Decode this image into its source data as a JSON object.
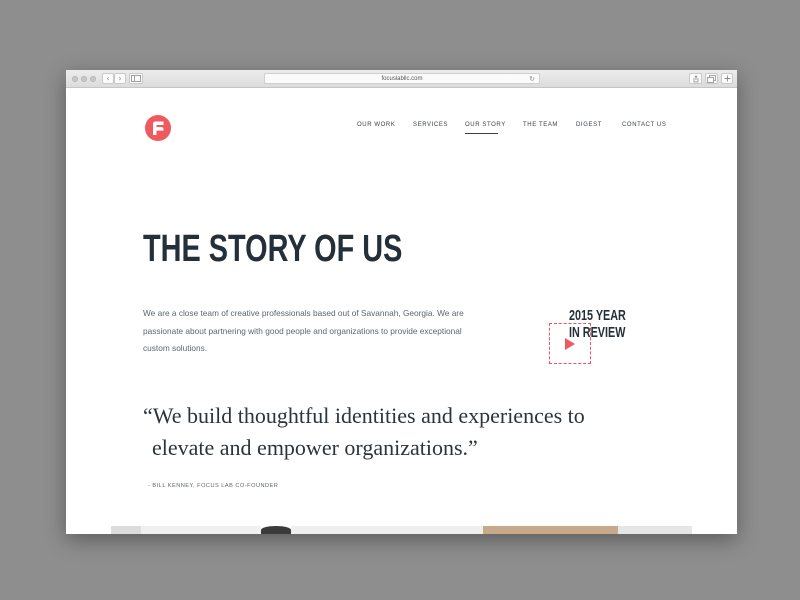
{
  "browser": {
    "url": "focuslabllc.com",
    "back_glyph": "‹",
    "forward_glyph": "›",
    "reload_glyph": "↻"
  },
  "brand": {
    "logo": "focus-lab-logo",
    "accent": "#ef5a5f"
  },
  "nav": {
    "items": [
      {
        "label": "OUR WORK"
      },
      {
        "label": "SERVICES"
      },
      {
        "label": "OUR STORY",
        "active": true
      },
      {
        "label": "THE TEAM"
      },
      {
        "label": "DIGEST"
      },
      {
        "label": "CONTACT US"
      }
    ]
  },
  "hero": {
    "title": "THE STORY OF US",
    "intro": "We are a close team of creative professionals based out of Savannah, Georgia. We are passionate about partnering with good people and organizations to provide exceptional custom solutions."
  },
  "video": {
    "line1": "2015 YEAR",
    "line2": "IN REVIEW",
    "icon": "play-icon"
  },
  "quote": {
    "line1": "“We build thoughtful identities and experiences to",
    "line2": "elevate and empower organizations.”",
    "attribution": "- BILL KENNEY, FOCUS LAB CO-FOUNDER"
  },
  "colors": {
    "heading": "#243039",
    "body_text": "#5d666d",
    "page_bg": "#8e8e8e",
    "window_bg": "#ffffff"
  }
}
